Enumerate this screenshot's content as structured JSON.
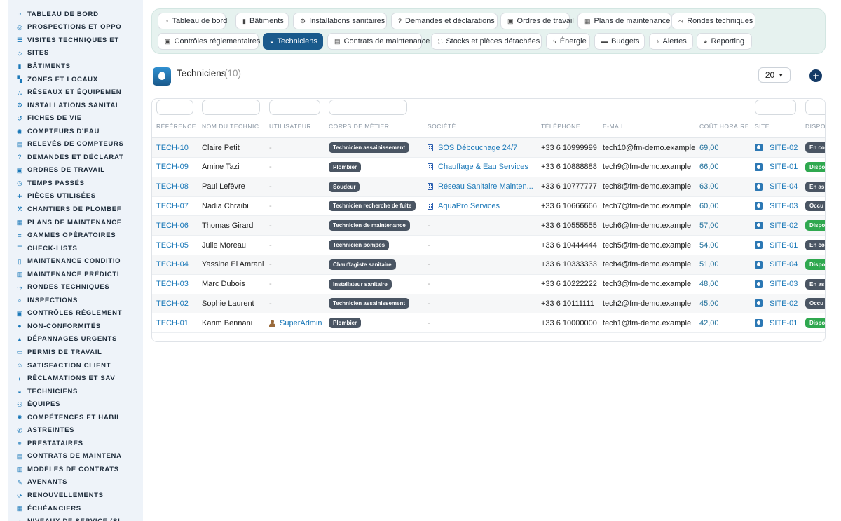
{
  "sidebar": {
    "items": [
      {
        "label": "TABLEAU DE BORD",
        "icon": "gauge-icon"
      },
      {
        "label": "PROSPECTIONS ET OPPO",
        "icon": "target-icon"
      },
      {
        "label": "VISITES TECHNIQUES ET",
        "icon": "checklist-icon"
      },
      {
        "label": "SITES",
        "icon": "map-pin-icon"
      },
      {
        "label": "BÂTIMENTS",
        "icon": "building-icon"
      },
      {
        "label": "ZONES ET LOCAUX",
        "icon": "zones-icon"
      },
      {
        "label": "RÉSEAUX ET ÉQUIPEMEN",
        "icon": "network-icon"
      },
      {
        "label": "INSTALLATIONS SANITAI",
        "icon": "gears-icon"
      },
      {
        "label": "FICHES DE VIE",
        "icon": "history-icon"
      },
      {
        "label": "COMPTEURS D'EAU",
        "icon": "meter-icon"
      },
      {
        "label": "RELEVÉS DE COMPTEURS",
        "icon": "readings-icon"
      },
      {
        "label": "DEMANDES ET DÉCLARAT",
        "icon": "question-icon"
      },
      {
        "label": "ORDRES DE TRAVAIL",
        "icon": "clipboard-icon"
      },
      {
        "label": "TEMPS PASSÉS",
        "icon": "clock-icon"
      },
      {
        "label": "PIÈCES UTILISÉES",
        "icon": "puzzle-icon"
      },
      {
        "label": "CHANTIERS DE PLOMBEF",
        "icon": "wrench-icon"
      },
      {
        "label": "PLANS DE MAINTENANCE",
        "icon": "calendar-icon"
      },
      {
        "label": "GAMMES OPÉRATOIRES",
        "icon": "list-icon"
      },
      {
        "label": "CHECK-LISTS",
        "icon": "checklist-icon"
      },
      {
        "label": "MAINTENANCE CONDITIO",
        "icon": "thermometer-icon"
      },
      {
        "label": "MAINTENANCE PRÉDICTI",
        "icon": "chart-icon"
      },
      {
        "label": "RONDES TECHNIQUES",
        "icon": "route-icon"
      },
      {
        "label": "INSPECTIONS",
        "icon": "magnifier-icon"
      },
      {
        "label": "CONTRÔLES RÉGLEMENT",
        "icon": "clipboard-check-icon"
      },
      {
        "label": "NON-CONFORMITÉS",
        "icon": "alert-circle-icon"
      },
      {
        "label": "DÉPANNAGES URGENTS",
        "icon": "warning-icon"
      },
      {
        "label": "PERMIS DE TRAVAIL",
        "icon": "document-icon"
      },
      {
        "label": "SATISFACTION CLIENT",
        "icon": "smile-icon"
      },
      {
        "label": "RÉCLAMATIONS ET SAV",
        "icon": "comment-icon"
      },
      {
        "label": "TECHNICIENS",
        "icon": "helmet-icon"
      },
      {
        "label": "ÉQUIPES",
        "icon": "users-icon"
      },
      {
        "label": "COMPÉTENCES ET HABIL",
        "icon": "certificate-icon"
      },
      {
        "label": "ASTREINTES",
        "icon": "phone-icon"
      },
      {
        "label": "PRESTATAIRES",
        "icon": "handshake-icon"
      },
      {
        "label": "CONTRATS DE MAINTENA",
        "icon": "contract-icon"
      },
      {
        "label": "MODÈLES DE CONTRATS",
        "icon": "template-icon"
      },
      {
        "label": "AVENANTS",
        "icon": "edit-document-icon"
      },
      {
        "label": "RENOUVELLEMENTS",
        "icon": "refresh-icon"
      },
      {
        "label": "ÉCHÉANCIERS",
        "icon": "schedule-icon"
      },
      {
        "label": "NIVEAUX DE SERVICE (SL",
        "icon": "gauge-icon"
      }
    ]
  },
  "tabs": {
    "row1": [
      {
        "label": "Tableau de bord",
        "icon": "gauge-icon"
      },
      {
        "label": "Bâtiments",
        "icon": "building-icon"
      },
      {
        "label": "Installations sanitaires",
        "icon": "gears-icon"
      },
      {
        "label": "Demandes et déclarations",
        "icon": "question-icon"
      },
      {
        "label": "Ordres de travail",
        "icon": "clipboard-icon"
      },
      {
        "label": "Plans de maintenance",
        "icon": "calendar-icon"
      },
      {
        "label": "Rondes techniques",
        "icon": "route-icon"
      }
    ],
    "row2": [
      {
        "label": "Contrôles réglementaires",
        "icon": "clipboard-check-icon"
      },
      {
        "label": "Techniciens",
        "icon": "helmet-icon",
        "active": true
      },
      {
        "label": "Contrats de maintenance",
        "icon": "contract-icon"
      },
      {
        "label": "Stocks et pièces détachées",
        "icon": "boxes-icon"
      },
      {
        "label": "Énergie",
        "icon": "bolt-icon"
      },
      {
        "label": "Budgets",
        "icon": "money-icon"
      },
      {
        "label": "Alertes",
        "icon": "bell-icon"
      },
      {
        "label": "Reporting",
        "icon": "pie-icon"
      }
    ]
  },
  "header": {
    "title": "Techniciens",
    "count": "(10)",
    "page_size": "20"
  },
  "table": {
    "columns": [
      "RÉFÉRENCE",
      "NOM DU TECHNIC...",
      "UTILISATEUR",
      "CORPS DE MÉTIER",
      "SOCIÉTÉ",
      "TÉLÉPHONE",
      "E-MAIL",
      "COÛT HORAIRE",
      "SITE",
      "DISPO"
    ],
    "rows": [
      {
        "ref": "TECH-10",
        "name": "Claire Petit",
        "user": "-",
        "trade": "Technicien assainissement",
        "company": "SOS Débouchage 24/7",
        "phone": "+33 6 10999999",
        "email": "tech10@fm-demo.example",
        "cost": "69,00",
        "site": "SITE-02",
        "dispo": "En co",
        "dispo_color": "#4a5563"
      },
      {
        "ref": "TECH-09",
        "name": "Amine Tazi",
        "user": "-",
        "trade": "Plombier",
        "company": "Chauffage & Eau Services",
        "phone": "+33 6 10888888",
        "email": "tech9@fm-demo.example",
        "cost": "66,00",
        "site": "SITE-01",
        "dispo": "Dispo",
        "dispo_color": "#2fa84f"
      },
      {
        "ref": "TECH-08",
        "name": "Paul Lefèvre",
        "user": "-",
        "trade": "Soudeur",
        "company": "Réseau Sanitaire Mainten...",
        "phone": "+33 6 10777777",
        "email": "tech8@fm-demo.example",
        "cost": "63,00",
        "site": "SITE-04",
        "dispo": "En as",
        "dispo_color": "#4a5563"
      },
      {
        "ref": "TECH-07",
        "name": "Nadia Chraibi",
        "user": "-",
        "trade": "Technicien recherche de fuite",
        "company": "AquaPro Services",
        "phone": "+33 6 10666666",
        "email": "tech7@fm-demo.example",
        "cost": "60,00",
        "site": "SITE-03",
        "dispo": "Occu",
        "dispo_color": "#4a5563"
      },
      {
        "ref": "TECH-06",
        "name": "Thomas Girard",
        "user": "-",
        "trade": "Technicien de maintenance",
        "company": "-",
        "phone": "+33 6 10555555",
        "email": "tech6@fm-demo.example",
        "cost": "57,00",
        "site": "SITE-02",
        "dispo": "Dispo",
        "dispo_color": "#2fa84f"
      },
      {
        "ref": "TECH-05",
        "name": "Julie Moreau",
        "user": "-",
        "trade": "Technicien pompes",
        "company": "-",
        "phone": "+33 6 10444444",
        "email": "tech5@fm-demo.example",
        "cost": "54,00",
        "site": "SITE-01",
        "dispo": "En co",
        "dispo_color": "#4a5563"
      },
      {
        "ref": "TECH-04",
        "name": "Yassine El Amrani",
        "user": "-",
        "trade": "Chauffagiste sanitaire",
        "company": "-",
        "phone": "+33 6 10333333",
        "email": "tech4@fm-demo.example",
        "cost": "51,00",
        "site": "SITE-04",
        "dispo": "Dispo",
        "dispo_color": "#2fa84f"
      },
      {
        "ref": "TECH-03",
        "name": "Marc Dubois",
        "user": "-",
        "trade": "Installateur sanitaire",
        "company": "-",
        "phone": "+33 6 10222222",
        "email": "tech3@fm-demo.example",
        "cost": "48,00",
        "site": "SITE-03",
        "dispo": "En as",
        "dispo_color": "#4a5563"
      },
      {
        "ref": "TECH-02",
        "name": "Sophie Laurent",
        "user": "-",
        "trade": "Technicien assainissement",
        "company": "-",
        "phone": "+33 6 10111111",
        "email": "tech2@fm-demo.example",
        "cost": "45,00",
        "site": "SITE-02",
        "dispo": "Occu",
        "dispo_color": "#4a5563"
      },
      {
        "ref": "TECH-01",
        "name": "Karim Bennani",
        "user": "SuperAdmin",
        "trade": "Plombier",
        "company": "-",
        "phone": "+33 6 10000000",
        "email": "tech1@fm-demo.example",
        "cost": "42,00",
        "site": "SITE-01",
        "dispo": "Dispo",
        "dispo_color": "#2fa84f"
      }
    ]
  },
  "colors": {
    "accent": "#1a5a8c",
    "link": "#1a78b8",
    "badge": "#4a5563",
    "available": "#2fa84f"
  }
}
